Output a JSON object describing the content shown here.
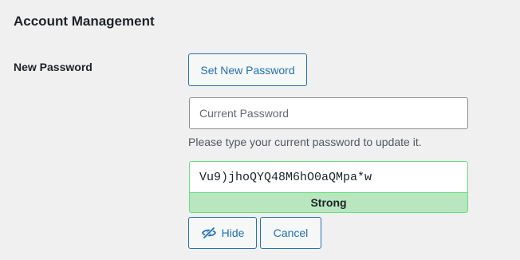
{
  "section": {
    "title": "Account Management"
  },
  "password_row": {
    "label": "New Password",
    "set_button_label": "Set New Password",
    "current_password_placeholder": "Current Password",
    "current_password_value": "",
    "hint": "Please type your current password to update it.",
    "new_password_value": "Vu9)jhoQYQ48M6hO0aQMpa*w",
    "strength_label": "Strong",
    "hide_button_label": "Hide",
    "hide_button_icon": "eye-slash-icon",
    "cancel_button_label": "Cancel"
  },
  "colors": {
    "accent": "#2271b1",
    "strength_bg": "#b8e6bf",
    "strength_border": "#68de7c",
    "page_bg": "#f0f0f1"
  }
}
